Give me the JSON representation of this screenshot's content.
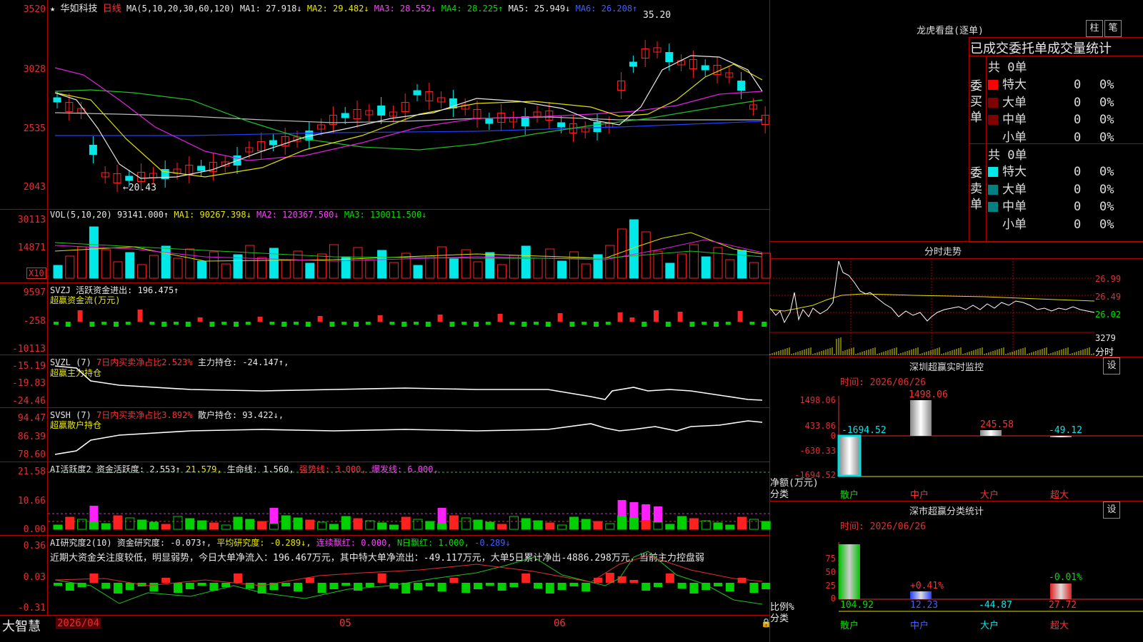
{
  "app": {
    "name": "大智慧",
    "date_start": "2026/04",
    "tick_may": "05",
    "tick_jun": "06"
  },
  "stock": {
    "name": "华如科技",
    "period": "日线"
  },
  "main": {
    "ma_title": "MA(5,10,20,30,60,120)",
    "ma1": "MA1: 27.918↓",
    "ma2": "MA2: 29.482↓",
    "ma3": "MA3: 28.552↓",
    "ma4": "MA4: 28.225↑",
    "ma5": "MA5: 25.949↓",
    "ma6": "MA6: 26.208↑",
    "y_labels": [
      "3520",
      "3028",
      "2535",
      "2043"
    ],
    "high_mark": "35.20",
    "low_mark": "←20.43"
  },
  "vol": {
    "title": "VOL(5,10,20)",
    "value": "93141.000↑",
    "ma1": "MA1: 90267.398↓",
    "ma2": "MA2: 120367.500↓",
    "ma3": "MA3: 130011.500↓",
    "y_labels": [
      "30113",
      "14871"
    ],
    "unit": "X10"
  },
  "svzj": {
    "title": "SVZJ",
    "desc": "活跃资金进出: 196.475↑",
    "sub": "超赢资金流(万元)",
    "y_labels": [
      "9597",
      "-258",
      "-10113"
    ]
  },
  "svzl": {
    "title": "SVZL (7)",
    "desc1": "7日内买卖净占比2.523%",
    "desc2": "主力持仓: -24.147↑,",
    "sub": "超赢主力持仓",
    "y_labels": [
      "-15.19",
      "-19.83",
      "-24.46"
    ]
  },
  "svsh": {
    "title": "SVSH (7)",
    "desc1": "7日内买卖净占比3.892%",
    "desc2": "散户持仓: 93.422↓,",
    "sub": "超赢散户持仓",
    "y_labels": [
      "94.47",
      "86.39",
      "78.60"
    ]
  },
  "ai1": {
    "title": "AI活跃度2",
    "desc": "资金活跃度: 2.553↑",
    "v2": "21.579,",
    "v3": "生命线: 1.560,",
    "v4": "强势线: 3.000,",
    "v5": "爆发线: 6.000,",
    "y_labels": [
      "21.58",
      "10.66",
      "0.00"
    ]
  },
  "ai2": {
    "title": "AI研究度2(10)",
    "desc": "资金研究度: -0.073↑,",
    "v2": "平均研究度: -0.289↓,",
    "v3": "连续飘红: 0.000,",
    "v4": "N日飘红: 1.000,",
    "v5": "-0.289↓",
    "comment": "近期大资金关注度较低，明显弱势，今日大单净流入：196.467万元，其中特大单净流出：-49.117万元，大单5日累计净出-4886.298万元，当前主力控盘弱",
    "y_labels": [
      "0.36",
      "0.03",
      "-0.31"
    ]
  },
  "right": {
    "lhb_title": "龙虎看盘(逐单)",
    "btn1": "柱",
    "btn2": "笔",
    "header": "已成交委托单成交量统计",
    "buy": {
      "label": "委买单",
      "total": "共 0单",
      "rows": [
        {
          "name": "特大",
          "val": "0",
          "pct": "0%"
        },
        {
          "name": "大单",
          "val": "0",
          "pct": "0%"
        },
        {
          "name": "中单",
          "val": "0",
          "pct": "0%"
        },
        {
          "name": "小单",
          "val": "0",
          "pct": "0%"
        }
      ]
    },
    "sell": {
      "label": "委卖单",
      "total": "共 0单",
      "rows": [
        {
          "name": "特大",
          "val": "0",
          "pct": "0%"
        },
        {
          "name": "大单",
          "val": "0",
          "pct": "0%"
        },
        {
          "name": "中单",
          "val": "0",
          "pct": "0%"
        },
        {
          "name": "小单",
          "val": "0",
          "pct": "0%"
        }
      ]
    },
    "fs_title": "分时走势",
    "fs_prices": [
      "26.99",
      "26.49",
      "26.02"
    ],
    "fs_vol": "3279",
    "fs_unit": "分时",
    "sz_title": "深圳超赢实时监控",
    "sz_btn": "设",
    "sz_time": "时间: 2026/06/26",
    "sz_y": [
      "1498.06",
      "433.86",
      "0",
      "-630.33",
      "-1694.52"
    ],
    "sz_bars": [
      {
        "label": "散户",
        "value": "-1694.52"
      },
      {
        "label": "中户",
        "value": "1498.06"
      },
      {
        "label": "大户",
        "value": "245.58"
      },
      {
        "label": "超大",
        "value": "-49.12"
      }
    ],
    "sz_ylabel": "净额(万元)",
    "sz_xlabel": "分类",
    "ss_title": "深市超赢分类统计",
    "ss_btn": "设",
    "ss_time": "时间: 2026/06/26",
    "ss_y": [
      "75",
      "50",
      "25",
      "0"
    ],
    "ss_bars": [
      {
        "label": "散户",
        "value": "104.92",
        "pct": ""
      },
      {
        "label": "中户",
        "value": "12.23",
        "pct": "+0.41%"
      },
      {
        "label": "大户",
        "value": "-44.87",
        "pct": ""
      },
      {
        "label": "超大",
        "value": "27.72",
        "pct": "-0.01%"
      }
    ],
    "ss_ylabel": "比例%",
    "ss_xlabel": "分类"
  }
}
